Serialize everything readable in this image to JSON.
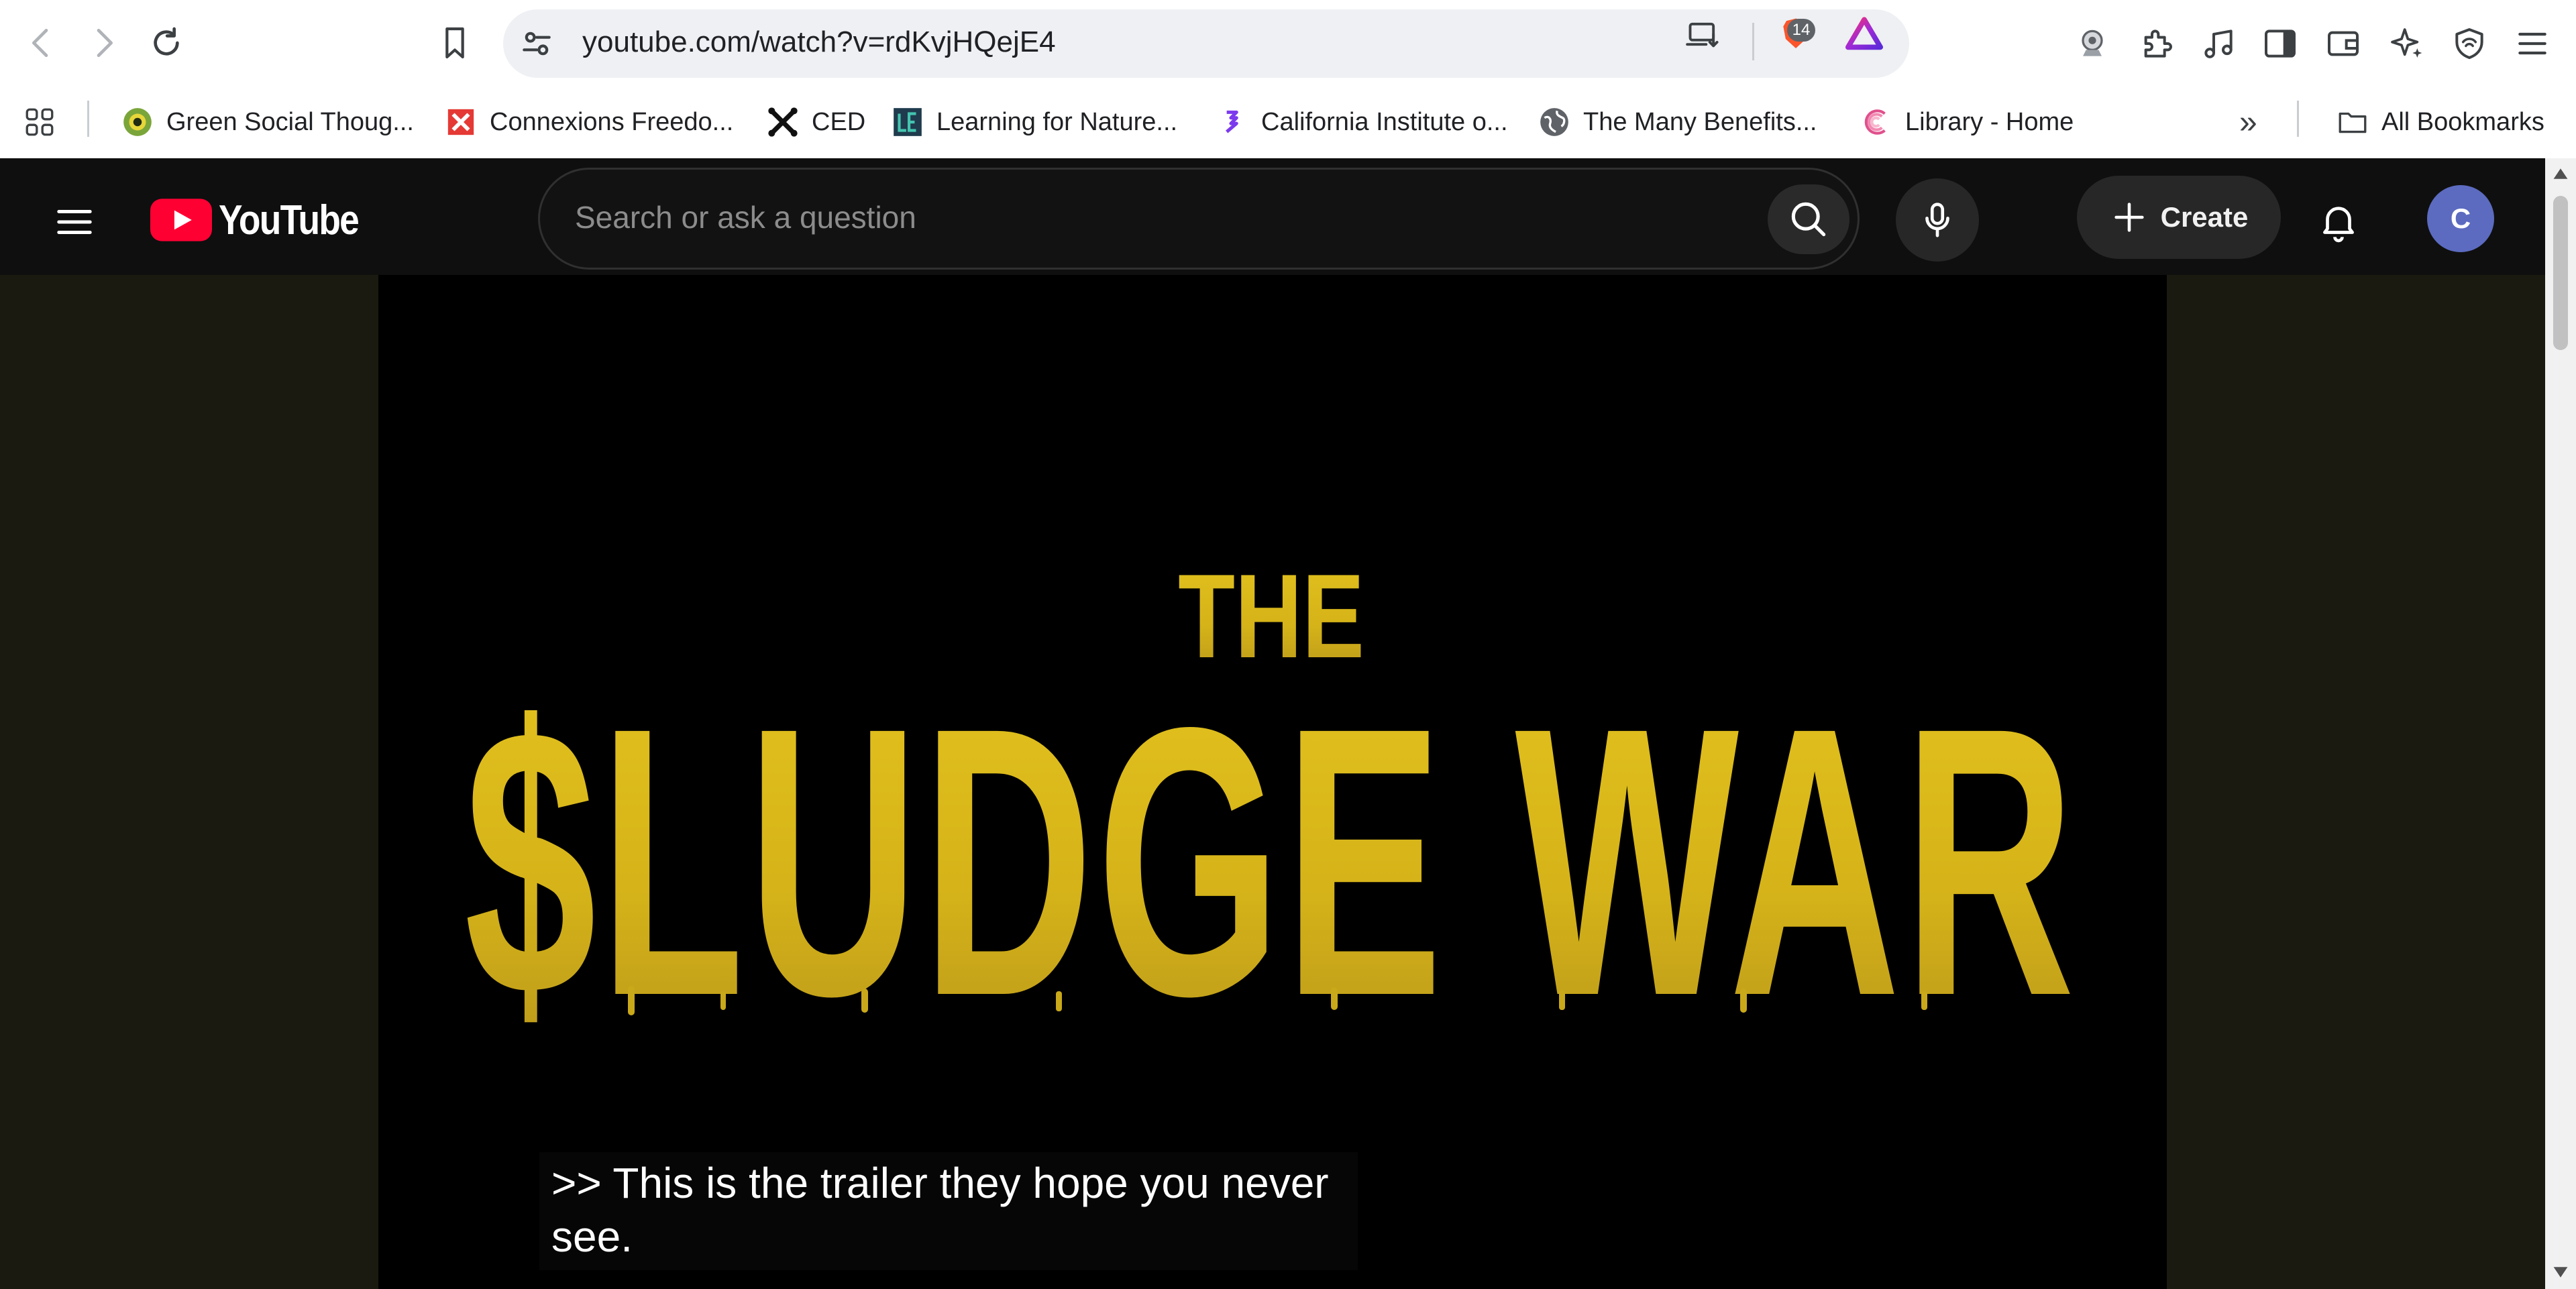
{
  "browser": {
    "url": "youtube.com/watch?v=rdKvjHQejE4",
    "brave_badge_count": "14",
    "bookmarks": [
      {
        "label": "Green Social Thoug...",
        "icon": "green-eye-favicon"
      },
      {
        "label": "Connexions Freedo...",
        "icon": "connexions-favicon"
      },
      {
        "label": "CED",
        "icon": "ced-favicon"
      },
      {
        "label": "Learning for Nature...",
        "icon": "learning-for-nature-favicon"
      },
      {
        "label": "California Institute o...",
        "icon": "california-institute-favicon"
      },
      {
        "label": "The Many Benefits...",
        "icon": "globe-favicon"
      },
      {
        "label": "Library - Home",
        "icon": "library-favicon"
      }
    ],
    "all_bookmarks_label": "All Bookmarks",
    "overflow_label": "»"
  },
  "youtube": {
    "logo_text": "YouTube",
    "search_placeholder": "Search or ask a question",
    "create_label": "Create",
    "avatar_letter": "C"
  },
  "video": {
    "title_small": "THE",
    "title_big": "$LUDGE WAR",
    "caption_line1": ">> This is the trailer they hope you never",
    "caption_line2": "see."
  },
  "colors": {
    "yt_red": "#ff0033",
    "title_gold": "#d4b21a",
    "avatar_bg": "#5c6bc0",
    "page_bg": "#0f0f0f"
  }
}
